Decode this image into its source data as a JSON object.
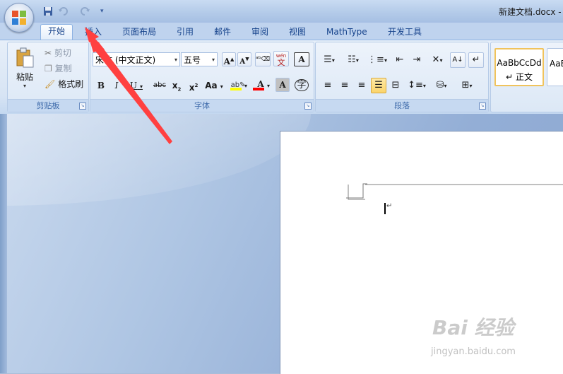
{
  "window": {
    "title": "新建文档.docx -"
  },
  "tabs": [
    {
      "label": "开始"
    },
    {
      "label": "插入"
    },
    {
      "label": "页面布局"
    },
    {
      "label": "引用"
    },
    {
      "label": "邮件"
    },
    {
      "label": "审阅"
    },
    {
      "label": "视图"
    },
    {
      "label": "MathType"
    },
    {
      "label": "开发工具"
    }
  ],
  "clipboard": {
    "paste": "粘贴",
    "cut": "剪切",
    "copy": "复制",
    "format_painter": "格式刷",
    "label": "剪贴板"
  },
  "font": {
    "name": "宋体 (中文正文)",
    "size": "五号",
    "label": "字体"
  },
  "paragraph": {
    "label": "段落"
  },
  "styles": {
    "style1": "AaBbCcDd",
    "style1_name": "正文",
    "style2": "AaB"
  },
  "watermark": {
    "brand": "Bai 经验",
    "url": "jingyan.baidu.com"
  },
  "colors": {
    "highlight": "#ffff00",
    "font_color": "#ff0000",
    "arrow": "#ff4040"
  }
}
